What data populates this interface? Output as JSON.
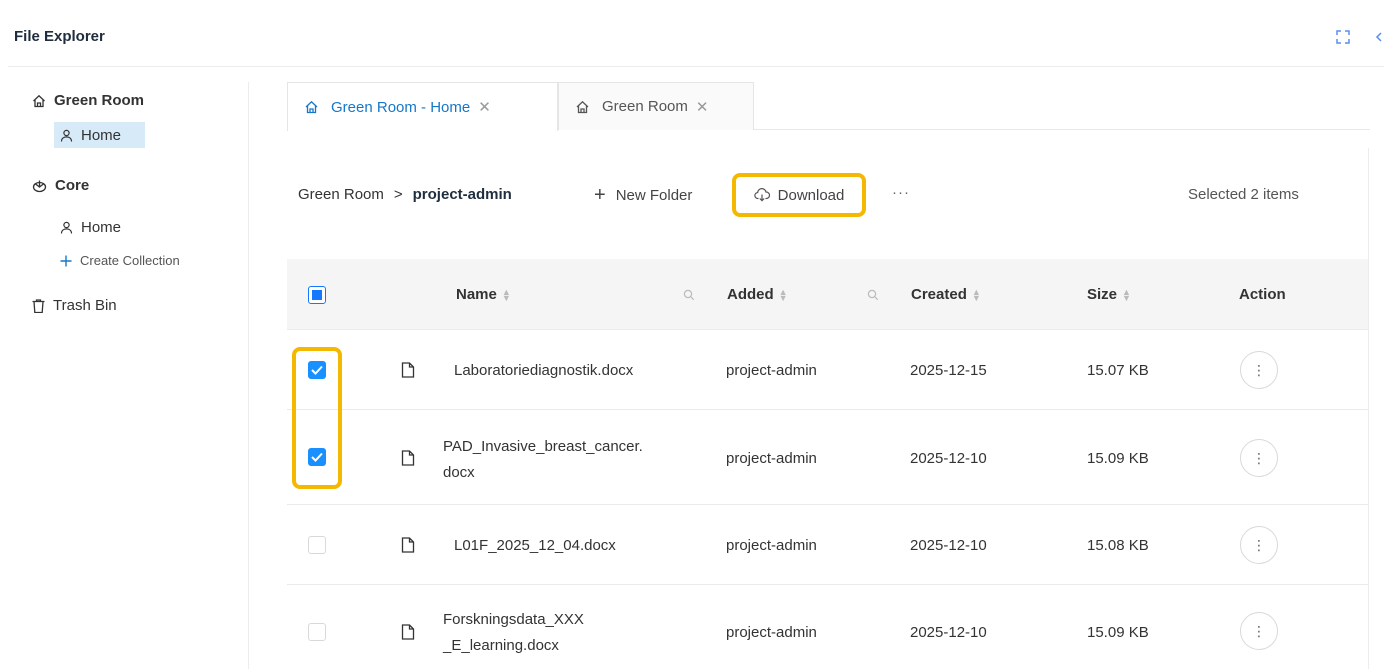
{
  "header": {
    "title": "File Explorer"
  },
  "sidebar": {
    "room": "Green Room",
    "room_home": "Home",
    "core": "Core",
    "core_home": "Home",
    "create_collection": "Create Collection",
    "trash": "Trash Bin"
  },
  "tabs": [
    {
      "label": "Green Room - Home",
      "active": true
    },
    {
      "label": "Green Room",
      "active": false
    }
  ],
  "toolbar": {
    "breadcrumb_root": "Green Room",
    "breadcrumb_sep": ">",
    "breadcrumb_current": "project-admin",
    "new_folder": "New Folder",
    "download": "Download",
    "more": "···",
    "selected": "Selected 2 items"
  },
  "table": {
    "columns": {
      "name": "Name",
      "added": "Added",
      "created": "Created",
      "size": "Size",
      "action": "Action"
    },
    "rows": [
      {
        "name": "Laboratoriediagnostik.docx",
        "added": "project-admin",
        "created": "2025-12-15",
        "size": "15.07 KB",
        "checked": true
      },
      {
        "name_line1": "PAD_Invasive_breast_cancer.",
        "name_line2": "docx",
        "added": "project-admin",
        "created": "2025-12-10",
        "size": "15.09 KB",
        "checked": true
      },
      {
        "name": "L01F_2025_12_04.docx",
        "added": "project-admin",
        "created": "2025-12-10",
        "size": "15.08 KB",
        "checked": false
      },
      {
        "name_line1": "Forskningsdata_XXX",
        "name_line2": "_E_learning.docx",
        "added": "project-admin",
        "created": "2025-12-10",
        "size": "15.09 KB",
        "checked": false
      }
    ]
  },
  "colors": {
    "accent": "#1677c8",
    "highlight": "#f5b800",
    "selected_bg": "#d6eaf8"
  }
}
